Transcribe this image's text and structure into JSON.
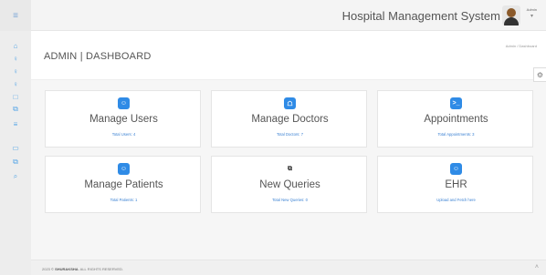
{
  "app": {
    "title": "Hospital Management System"
  },
  "user": {
    "name": "Admin",
    "caret": "▾"
  },
  "topbar": {
    "menu_icon": "≡"
  },
  "sidebar": {
    "icons": [
      {
        "name": "home-icon",
        "glyph": "⌂"
      },
      {
        "name": "user-icon",
        "glyph": "♀"
      },
      {
        "name": "user-icon-2",
        "glyph": "♀"
      },
      {
        "name": "user-icon-3",
        "glyph": "♀"
      },
      {
        "name": "document-icon",
        "glyph": "□"
      },
      {
        "name": "copy-icon",
        "glyph": "⧉"
      },
      {
        "name": "list-icon",
        "glyph": "≡"
      },
      {
        "name": "card-icon",
        "glyph": "▭"
      },
      {
        "name": "copy-icon-2",
        "glyph": "⧉"
      },
      {
        "name": "search-icon",
        "glyph": "⌕"
      }
    ]
  },
  "page": {
    "title": "ADMIN | DASHBOARD",
    "breadcrumb": "Admin  /  Dashboard",
    "gear_icon": "⚙"
  },
  "cards": [
    {
      "title": "Manage Users",
      "sub": "Total Users: 4",
      "icon": "☺"
    },
    {
      "title": "Manage Doctors",
      "sub": "Total Doctors: 7",
      "icon": "☖"
    },
    {
      "title": "Appointments",
      "sub": "Total Appointments: 3",
      "icon": ">_"
    },
    {
      "title": "Manage Patients",
      "sub": "Total Patients: 1",
      "icon": "☺"
    },
    {
      "title": "New Queries",
      "sub": "Total New Queries: 0",
      "icon": "⧉"
    },
    {
      "title": "EHR",
      "sub": "Upload and Fetch here",
      "icon": "☺"
    }
  ],
  "footer": {
    "prefix": "2023 ©",
    "brand": "SHURAKSHA",
    "suffix": ". ALL RIGHTS RESERVED.",
    "up_icon": "˄"
  }
}
